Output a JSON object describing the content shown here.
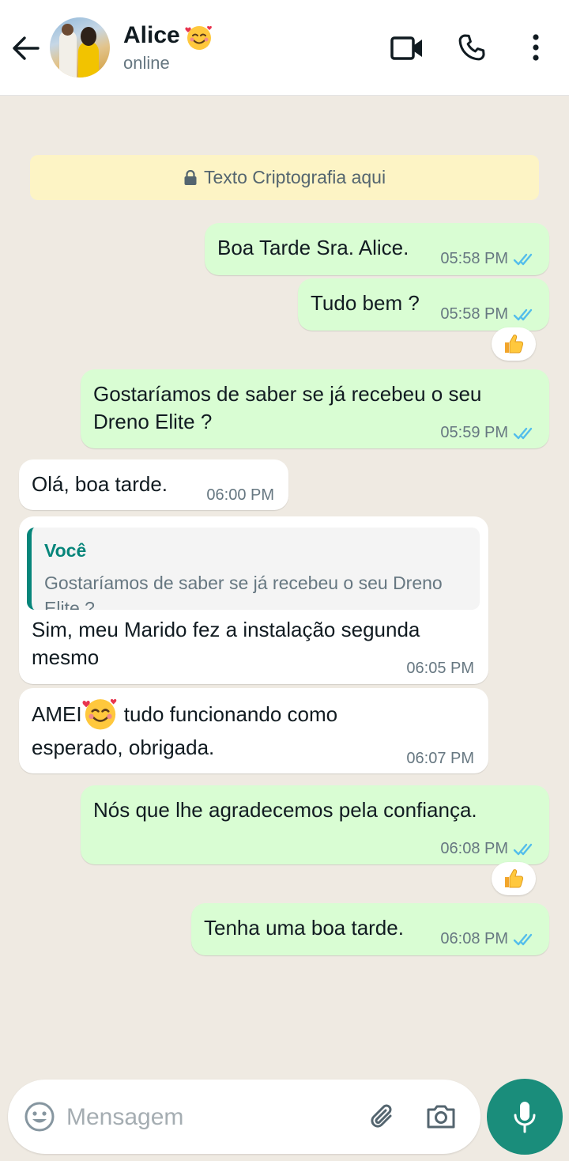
{
  "header": {
    "contact_name": "Alice",
    "status": "online",
    "icons": [
      "back-arrow-icon",
      "smiling-face-with-hearts-icon",
      "video-call-icon",
      "phone-icon",
      "more-options-icon"
    ]
  },
  "encryption_notice": {
    "text": "Texto Criptografia aqui",
    "icon": "lock-icon"
  },
  "messages": [
    {
      "direction": "out",
      "text": "Boa Tarde Sra. Alice.",
      "time": "05:58 PM",
      "status": "read"
    },
    {
      "direction": "out",
      "text": "Tudo bem ?",
      "time": "05:58 PM",
      "status": "read",
      "reaction": "thumbs-up"
    },
    {
      "direction": "out",
      "text": "Gostaríamos de saber se já recebeu o seu Dreno Elite ?",
      "text_line1": "Gostaríamos de saber se já recebeu o seu",
      "text_line2": "Dreno Elite ?",
      "time": "05:59 PM",
      "status": "read"
    },
    {
      "direction": "in",
      "text": "Olá, boa tarde.",
      "time": "06:00 PM"
    },
    {
      "direction": "in",
      "quote": {
        "author": "Você",
        "text": "Gostaríamos de saber se já recebeu o seu Dreno Elite ?"
      },
      "text_line1": "Sim, meu Marido fez a instalação segunda",
      "text_line2": "mesmo",
      "time": "06:05 PM"
    },
    {
      "direction": "in",
      "text_before_emoji": "AMEI",
      "text_after_emoji": " tudo funcionando como",
      "text_line2": "esperado, obrigada.",
      "time": "06:07 PM"
    },
    {
      "direction": "out",
      "text": "Nós que lhe agradecemos pela confiança.",
      "time": "06:08 PM",
      "status": "read",
      "reaction": "thumbs-up"
    },
    {
      "direction": "out",
      "text": "Tenha uma boa tarde.",
      "time": "06:08 PM",
      "status": "read"
    }
  ],
  "composer": {
    "placeholder": "Mensagem",
    "icons": [
      "emoji-icon",
      "attach-icon",
      "camera-icon",
      "microphone-icon"
    ]
  },
  "colors": {
    "accent": "#1a8d7b",
    "outgoing_bubble": "#d9fdd3",
    "read_ticks": "#53bdeb",
    "chat_bg": "#efeae2",
    "notice_bg": "#fdf4c5"
  }
}
